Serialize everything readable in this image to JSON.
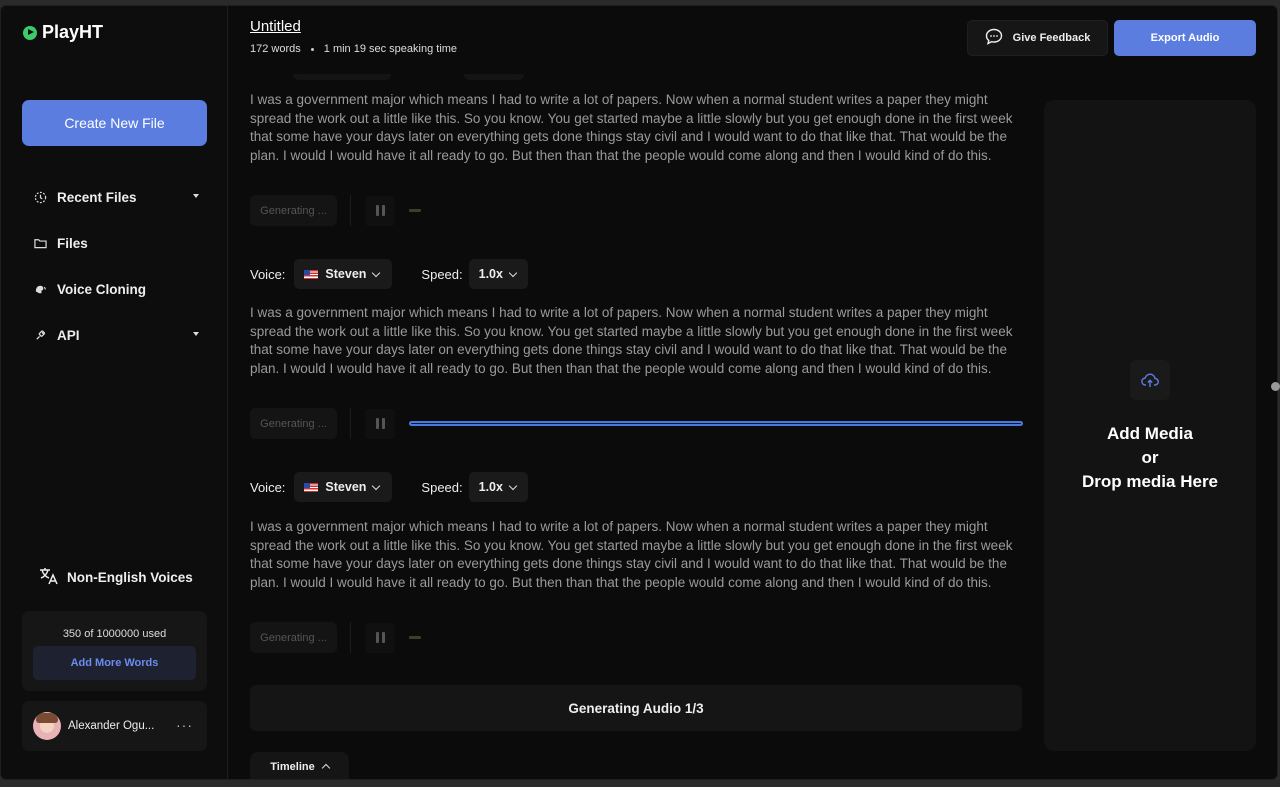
{
  "app": {
    "brand": "PlayHT"
  },
  "sidebar": {
    "create_label": "Create New File",
    "items": [
      {
        "label": "Recent Files",
        "icon": "clock-icon",
        "has_caret": true
      },
      {
        "label": "Files",
        "icon": "folder-icon",
        "has_caret": false
      },
      {
        "label": "Voice Cloning",
        "icon": "voice-clone-icon",
        "has_caret": false
      },
      {
        "label": "API",
        "icon": "api-icon",
        "has_caret": true
      }
    ],
    "non_english_label": "Non-English Voices",
    "usage_text": "350 of 1000000 used",
    "add_words_label": "Add More Words",
    "user_name": "Alexander Ogu...",
    "more_label": "···"
  },
  "header": {
    "title": "Untitled",
    "word_count": "172 words",
    "speaking_time": "1 min 19 sec speaking time",
    "feedback_label": "Give Feedback",
    "export_label": "Export Audio"
  },
  "blocks": [
    {
      "text": "I was a government major which means I had to write a lot of papers. Now when a normal student writes a paper they might spread the work out a little like this. So you know. You get started maybe a little slowly but you get enough done in the first week that some have your days later on everything gets done things stay civil and I would want to do that like that. That would be the plan. I would I would have it all ready to go. But then than that the people would come along and then I would kind of do this.",
      "generating_label": "Generating ...",
      "progress": 0.02
    },
    {
      "voice_label": "Voice:",
      "voice": "Steven",
      "speed_label": "Speed:",
      "speed": "1.0x",
      "text": "I was a government major which means I had to write a lot of papers. Now when a normal student writes a paper they might spread the work out a little like this. So you know. You get started maybe a little slowly but you get enough done in the first week that some have your days later on everything gets done things stay civil and I would want to do that like that. That would be the plan. I would I would have it all ready to go. But then than that the people would come along and then I would kind of do this.",
      "generating_label": "Generating ...",
      "progress": 1.0
    },
    {
      "voice_label": "Voice:",
      "voice": "Steven",
      "speed_label": "Speed:",
      "speed": "1.0x",
      "text": "I was a government major which means I had to write a lot of papers. Now when a normal student writes a paper they might spread the work out a little like this. So you know. You get started maybe a little slowly but you get enough done in the first week that some have your days later on everything gets done things stay civil and I would want to do that like that. That would be the plan. I would I would have it all ready to go. But then than that the people would come along and then I would kind of do this.",
      "generating_label": "Generating ...",
      "progress": 0.02
    }
  ],
  "status": {
    "label": "Generating Audio 1/3"
  },
  "timeline": {
    "label": "Timeline"
  },
  "media": {
    "line1": "Add Media",
    "line2": "or",
    "line3": "Drop media Here"
  },
  "colors": {
    "accent": "#5b7de0",
    "brand_green": "#3ec96b",
    "background": "#0b0b0b"
  }
}
